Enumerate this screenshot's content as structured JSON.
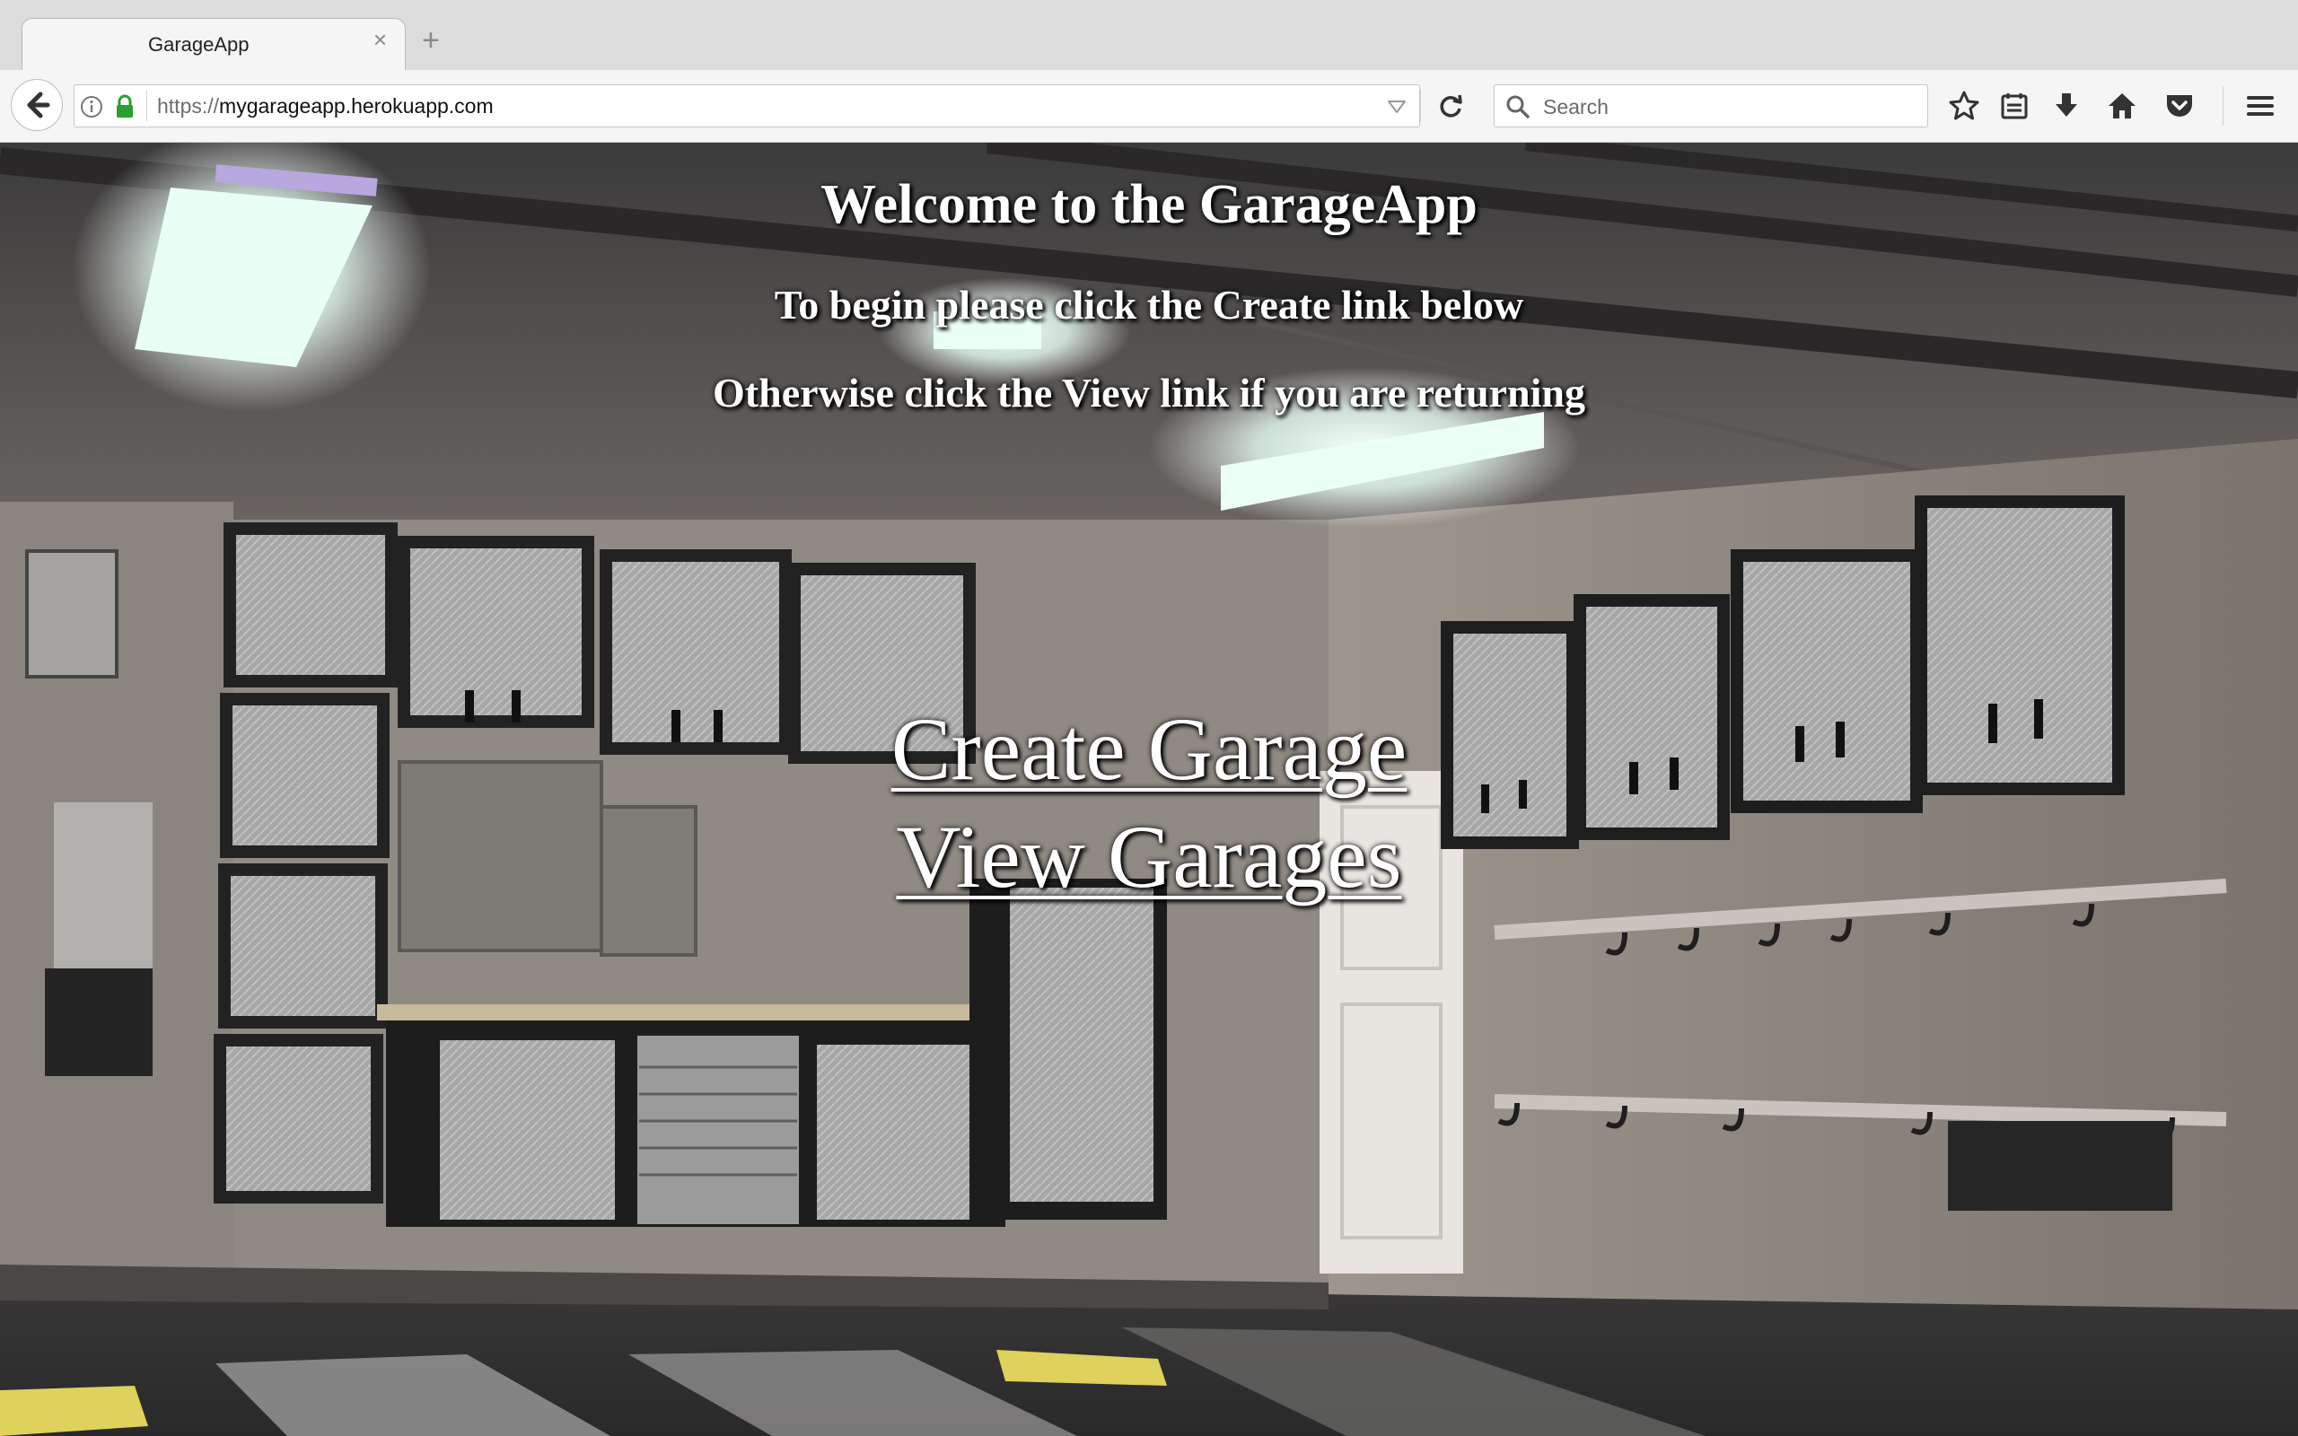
{
  "browser": {
    "tab_title": "GarageApp",
    "tab_close": "×",
    "new_tab": "+",
    "url_protocol": "https://",
    "url_host": "mygarageapp.herokuapp.com",
    "search_placeholder": "Search"
  },
  "page": {
    "welcome": "Welcome to the GarageApp",
    "line1": "To begin please click the Create link below",
    "line2": "Otherwise click the View link if you are returning",
    "create_link": "Create Garage",
    "view_link": "View Garages"
  },
  "icons": {
    "back": "back-arrow-icon",
    "info": "info-icon",
    "lock": "lock-icon",
    "dropdown": "dropdown-arrow-icon",
    "reload": "reload-icon",
    "search": "search-icon",
    "bookmark": "star-icon",
    "library": "library-icon",
    "download": "download-icon",
    "home": "home-icon",
    "pocket": "pocket-icon",
    "menu": "hamburger-icon"
  },
  "colors": {
    "lock_green": "#2e9e32",
    "page_text": "#ffffff"
  }
}
